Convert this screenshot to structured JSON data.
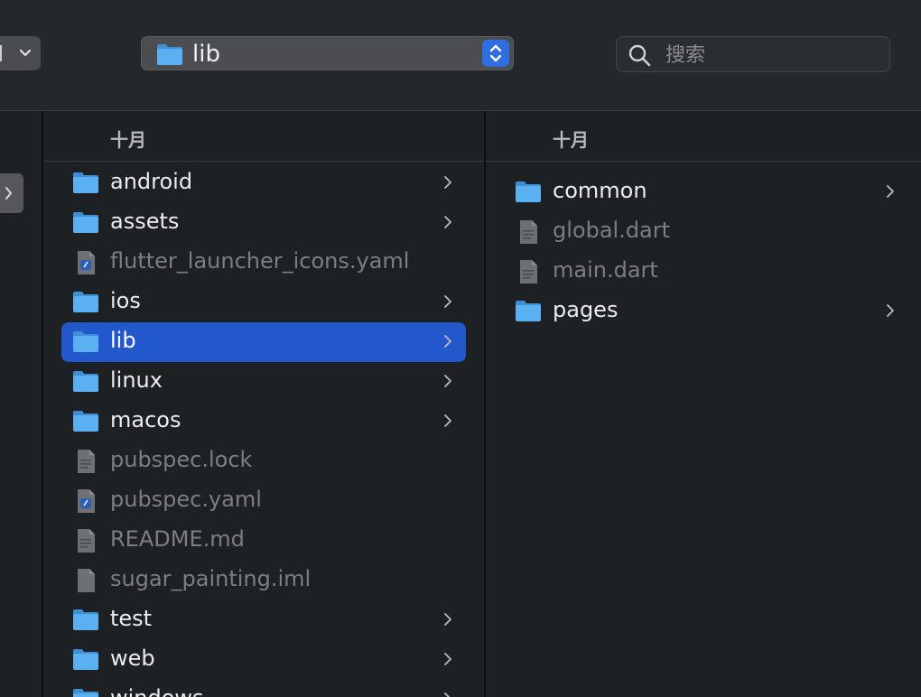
{
  "toolbar": {
    "view_popup_glyph": "grid-view",
    "path_popup": {
      "label": "lib",
      "icon": "folder-icon"
    },
    "search": {
      "placeholder": "搜索",
      "value": ""
    }
  },
  "columns": [
    {
      "header": "十月",
      "items": [
        {
          "name": "android",
          "kind": "folder"
        },
        {
          "name": "assets",
          "kind": "folder"
        },
        {
          "name": "flutter_launcher_icons.yaml",
          "kind": "yaml"
        },
        {
          "name": "ios",
          "kind": "folder"
        },
        {
          "name": "lib",
          "kind": "folder",
          "selected": true
        },
        {
          "name": "linux",
          "kind": "folder"
        },
        {
          "name": "macos",
          "kind": "folder"
        },
        {
          "name": "pubspec.lock",
          "kind": "doc"
        },
        {
          "name": "pubspec.yaml",
          "kind": "yaml"
        },
        {
          "name": "README.md",
          "kind": "doc"
        },
        {
          "name": "sugar_painting.iml",
          "kind": "blank"
        },
        {
          "name": "test",
          "kind": "folder"
        },
        {
          "name": "web",
          "kind": "folder"
        },
        {
          "name": "windows",
          "kind": "folder"
        }
      ]
    },
    {
      "header": "十月",
      "items": [
        {
          "name": "common",
          "kind": "folder"
        },
        {
          "name": "global.dart",
          "kind": "doc"
        },
        {
          "name": "main.dart",
          "kind": "doc"
        },
        {
          "name": "pages",
          "kind": "folder"
        }
      ]
    }
  ],
  "colors": {
    "selection": "#2358cc",
    "folder_front": "#5ab0f0",
    "folder_back": "#3d8fd6",
    "stepper": "#2e6ee0"
  }
}
